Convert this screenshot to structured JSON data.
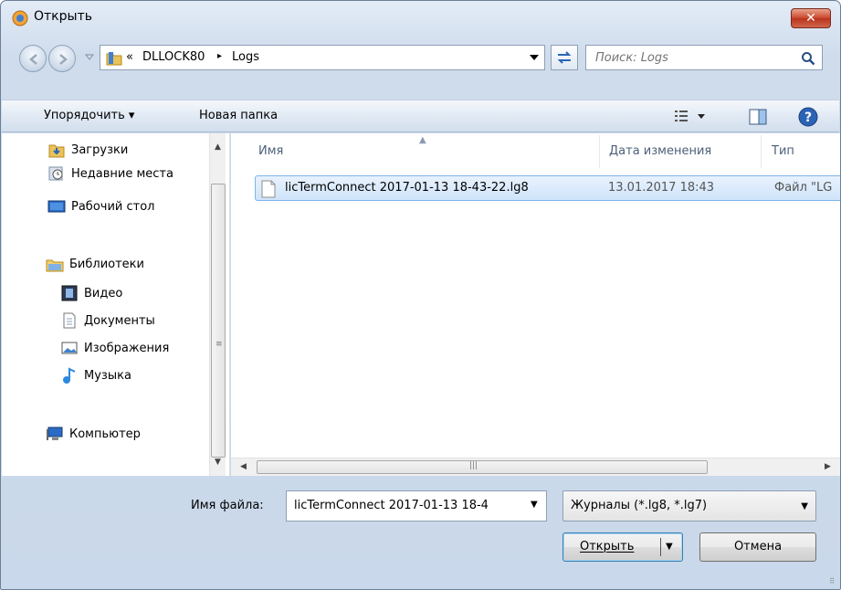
{
  "window": {
    "title": "Открыть"
  },
  "address": {
    "chevron": "«",
    "parts": [
      "DLLOCK80",
      "Logs"
    ],
    "separator": "▸"
  },
  "search": {
    "placeholder": "Поиск: Logs"
  },
  "toolbar": {
    "organize_label": "Упорядочить ▾",
    "newfolder_label": "Новая папка"
  },
  "nav": {
    "items": [
      {
        "label": "Загрузки",
        "icon": "downloads-folder-icon"
      },
      {
        "label": "Недавние места",
        "icon": "recent-places-icon"
      },
      {
        "label": "Рабочий стол",
        "icon": "desktop-icon"
      },
      {
        "label": "Библиотеки",
        "icon": "libraries-icon"
      },
      {
        "label": "Видео",
        "icon": "video-icon"
      },
      {
        "label": "Документы",
        "icon": "documents-icon"
      },
      {
        "label": "Изображения",
        "icon": "pictures-icon"
      },
      {
        "label": "Музыка",
        "icon": "music-icon"
      },
      {
        "label": "Компьютер",
        "icon": "computer-icon"
      }
    ]
  },
  "columns": [
    "Имя",
    "Дата изменения",
    "Тип"
  ],
  "files": [
    {
      "name": "licTermConnect 2017-01-13 18-43-22.lg8",
      "date": "13.01.2017 18:43",
      "type": "Файл \"LG"
    }
  ],
  "bottom": {
    "filename_label": "Имя файла:",
    "filename_value": "licTermConnect 2017-01-13 18-4",
    "filter_value": "Журналы (*.lg8, *.lg7)",
    "open_label": "Открыть",
    "cancel_label": "Отмена"
  },
  "colors": {
    "accent": "#3c7fb1",
    "selection": "#cfe4fa",
    "close": "#c9452a"
  }
}
